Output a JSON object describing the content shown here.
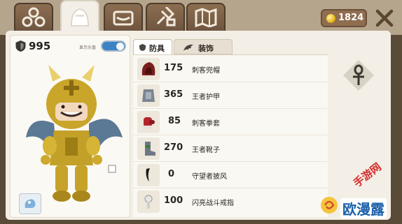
{
  "topbar": {
    "tabs": [
      {
        "id": "team",
        "icon": "team-icon",
        "active": false
      },
      {
        "id": "helmet",
        "icon": "helmet-icon",
        "active": true
      },
      {
        "id": "chest",
        "icon": "chest-icon",
        "active": false
      },
      {
        "id": "craft",
        "icon": "craft-icon",
        "active": false
      },
      {
        "id": "map",
        "icon": "map-icon",
        "active": false
      }
    ],
    "coins": "1824",
    "coin_icon": "coin-icon",
    "close_icon": "close-icon"
  },
  "character": {
    "defense": "995",
    "defense_icon": "shield-icon",
    "toggle_label": "显示头盔",
    "toggle_on": true
  },
  "subtabs": [
    {
      "label": "防具",
      "icon": "shield-icon",
      "active": true
    },
    {
      "label": "装饰",
      "icon": "wing-icon",
      "active": false
    }
  ],
  "items": [
    {
      "value": "175",
      "name": "刺客兜帽",
      "icon": "hood-icon"
    },
    {
      "value": "365",
      "name": "王者护甲",
      "icon": "armor-icon"
    },
    {
      "value": "85",
      "name": "刺客拳套",
      "icon": "glove-icon"
    },
    {
      "value": "270",
      "name": "王者靴子",
      "icon": "boot-icon"
    },
    {
      "value": "0",
      "name": "守望者披风",
      "icon": "cape-icon"
    },
    {
      "value": "100",
      "name": "闪亮战斗戒指",
      "icon": "ring-icon"
    }
  ],
  "side_slot": {
    "icon": "ankh-icon"
  },
  "watermark": {
    "line1": "手游网",
    "line2": "欧漫露"
  }
}
